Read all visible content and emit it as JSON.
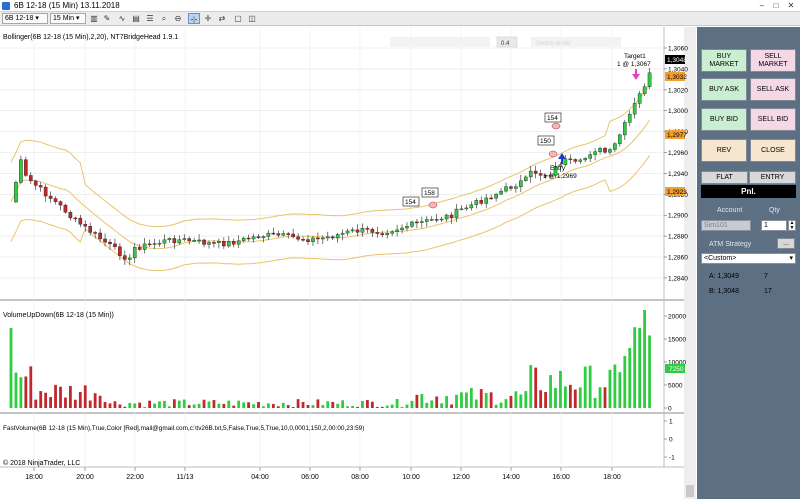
{
  "window": {
    "title": "6B 12-18 (15 Min) 13.11.2018"
  },
  "toolbar": {
    "instrument": "6B 12-18",
    "interval": "15 Min"
  },
  "chart": {
    "indicator_label": "Bollinger(6B 12-18 (15 Min),2,20), NT7BridgeHead 1.9.1",
    "small_box_value": "0.4",
    "small_box_faded": "Switch mode",
    "y_ticks": [
      "1,3060",
      "1,3040",
      "1,3020",
      "1,3000",
      "1,2980",
      "1,2960",
      "1,2940",
      "1,2920",
      "1,2900",
      "1,2880",
      "1,2860",
      "1,2840"
    ],
    "last_price_tag": "1,3048",
    "ask_tag": "1,3032",
    "order_tag": "1,2977",
    "lower_tag": "1,2923",
    "entry_text_1": "Entry",
    "entry_text_2": "1 @ 1,2969",
    "target_text_1": "Target1",
    "target_text_2": "1 @ 1,3067",
    "markers": [
      "154",
      "158",
      "150",
      "154"
    ]
  },
  "volume": {
    "label": "VolumeUpDown(6B 12-18 (15 Min))",
    "y_ticks": [
      "20000",
      "15000",
      "10000",
      "5000",
      "0"
    ],
    "last_tag": "7250"
  },
  "fastvolume": {
    "label": "FastVolume(6B 12-18 (15 Min),True,Color [Red],mail@gmail.com,c:\\tv26B.txt,5,False,True,5,True,10,0,0001,150,2,00:00,23:59)",
    "y_ticks": [
      "1",
      "0",
      "-1"
    ]
  },
  "copyright": "© 2018 NinjaTrader, LLC",
  "x_ticks": [
    "18:00",
    "20:00",
    "22:00",
    "11/13",
    "04:00",
    "06:00",
    "08:00",
    "10:00",
    "12:00",
    "14:00",
    "16:00",
    "18:00"
  ],
  "order_panel": {
    "buy_market": "BUY MARKET",
    "sell_market": "SELL MARKET",
    "buy_ask": "BUY ASK",
    "sell_ask": "SELL ASK",
    "buy_bid": "BUY BID",
    "sell_bid": "SELL BID",
    "rev": "REV",
    "close": "CLOSE",
    "flat": "FLAT",
    "entry": "ENTRY",
    "pnl": "Pnl.",
    "account_label": "Account",
    "qty_label": "Qty",
    "account_value": "Sim101",
    "qty_value": "1",
    "atm_label": "ATM Strategy",
    "atm_button": "...",
    "atm_value": "<Custom>",
    "ask_label": "A: 1,3049",
    "ask_size": "7",
    "bid_label": "B: 1,3048",
    "bid_size": "17"
  },
  "colors": {
    "up": "#2ecc40",
    "down": "#c0282d",
    "band": "#e9c46a",
    "panel": "#5d6f82"
  }
}
